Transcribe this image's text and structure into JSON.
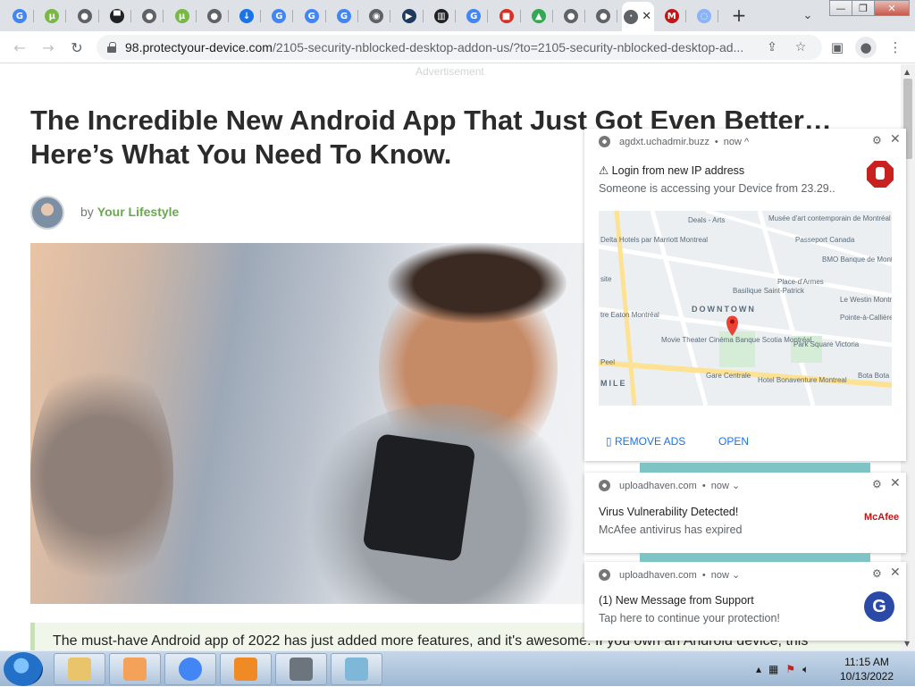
{
  "tabs": [
    {
      "icon": "google-icon",
      "color": "#4285f4",
      "glyph": "G"
    },
    {
      "icon": "utorrent-icon",
      "color": "#78b843",
      "glyph": "μ"
    },
    {
      "icon": "globe-icon",
      "color": "#5f6368",
      "glyph": "●"
    },
    {
      "icon": "car-icon",
      "color": "#202124",
      "glyph": "▀"
    },
    {
      "icon": "globe-icon",
      "color": "#5f6368",
      "glyph": "●"
    },
    {
      "icon": "utorrent-icon",
      "color": "#78b843",
      "glyph": "μ"
    },
    {
      "icon": "globe-icon",
      "color": "#5f6368",
      "glyph": "●"
    },
    {
      "icon": "download-icon",
      "color": "#1a73e8",
      "glyph": "↓"
    },
    {
      "icon": "google-icon",
      "color": "#4285f4",
      "glyph": "G"
    },
    {
      "icon": "google-icon",
      "color": "#4285f4",
      "glyph": "G"
    },
    {
      "icon": "google-icon",
      "color": "#4285f4",
      "glyph": "G"
    },
    {
      "icon": "chrome-icon",
      "color": "#5f6368",
      "glyph": "◉"
    },
    {
      "icon": "play-icon",
      "color": "#1f3a5f",
      "glyph": "▶"
    },
    {
      "icon": "bank-icon",
      "color": "#202124",
      "glyph": "▥"
    },
    {
      "icon": "google-icon",
      "color": "#4285f4",
      "glyph": "G"
    },
    {
      "icon": "lock-red-icon",
      "color": "#d93025",
      "glyph": "■"
    },
    {
      "icon": "cloud-icon",
      "color": "#34a853",
      "glyph": "▲"
    },
    {
      "icon": "globe-icon",
      "color": "#5f6368",
      "glyph": "●"
    },
    {
      "icon": "globe-icon",
      "color": "#5f6368",
      "glyph": "●"
    },
    {
      "icon": "active-tab-icon",
      "color": "#5f6368",
      "glyph": "·",
      "active": true
    },
    {
      "icon": "mcafee-icon",
      "color": "#c01818",
      "glyph": "M"
    },
    {
      "icon": "loading-icon",
      "color": "#8ab4f8",
      "glyph": "◌"
    }
  ],
  "window": {
    "minimize": "—",
    "restore": "❐",
    "close": "✕"
  },
  "address": {
    "domain": "98.protectyour-device.com",
    "path": "/2105-security-nblocked-desktop-addon-us/?to=2105-security-nblocked-desktop-ad..."
  },
  "page": {
    "ad_label": "Advertisement",
    "headline": "The Incredible New Android App That Just Got Even Better… Here’s What You Need To Know.",
    "byline_prefix": "by",
    "author": "Your Lifestyle",
    "quote": "The must-have Android app of 2022 has just added more features, and it's awesome. If you own an Android device, this"
  },
  "notifications": [
    {
      "site": "agdxt.uchadmir.buzz",
      "time": "now ^",
      "title": "⚠ Login from new IP address",
      "body": "Someone is accessing your Device from 23.29..",
      "actions": [
        "▯ REMOVE ADS",
        "OPEN"
      ],
      "map_labels": [
        "Deals - Arts",
        "Musée d'art contemporain de Montréal",
        "Delta Hotels par Marriott Montreal",
        "Passeport Canada",
        "BMO Banque de Montréal",
        "Basilique Saint-Patrick",
        "Place-d'Armes",
        "Le Westin Montréal",
        "DOWNTOWN",
        "Pointe-à-Callière",
        "Movie Theater Cinéma Banque Scotia Montréal",
        "Park Square Victoria",
        "Gare Centrale",
        "Hotel Bonaventure Montreal",
        "Bota Bota",
        "MILE",
        "site",
        "Peel",
        "tre Eaton Montréal"
      ]
    },
    {
      "site": "uploadhaven.com",
      "time": "now ⌄",
      "title": "Virus Vulnerability Detected!",
      "body": "McAfee antivirus has expired",
      "logo": "McAfee"
    },
    {
      "site": "uploadhaven.com",
      "time": "now ⌄",
      "title": "(1) New Message from Support",
      "body": "Tap here to continue your protection!",
      "avatar": "G"
    }
  ],
  "taskbar": {
    "apps": [
      "explorer-icon",
      "media-player-icon",
      "chrome-icon",
      "avast-icon",
      "settings-icon",
      "notepad-icon"
    ],
    "time": "11:15 AM",
    "date": "10/13/2022"
  }
}
